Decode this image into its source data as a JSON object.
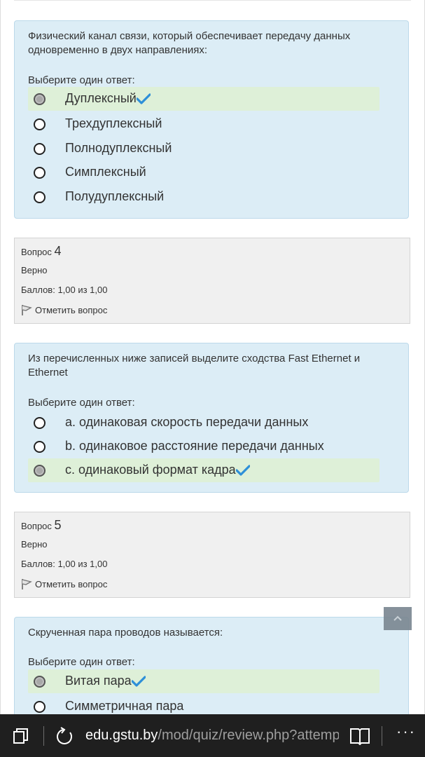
{
  "q3": {
    "text": "Физический канал связи, который обеспечивает передачу данных одновременно в двух направлениях:",
    "prompt": "Выберите один ответ:",
    "answers": [
      {
        "label": "Дуплексный",
        "checked": true,
        "correct": true
      },
      {
        "label": "Трехдуплексный",
        "checked": false,
        "correct": false
      },
      {
        "label": "Полнодуплексный",
        "checked": false,
        "correct": false
      },
      {
        "label": "Симплексный",
        "checked": false,
        "correct": false
      },
      {
        "label": "Полудуплексный",
        "checked": false,
        "correct": false
      }
    ]
  },
  "qb4": {
    "label": "Вопрос",
    "number": "4",
    "status": "Верно",
    "score": "Баллов: 1,00 из 1,00",
    "flag": "Отметить вопрос"
  },
  "q4": {
    "text": "Из перечисленных ниже записей выделите сходства Fast Ethernet и Ethernet",
    "prompt": "Выберите один ответ:",
    "answers": [
      {
        "label": "a. одинаковая скорость передачи данных",
        "checked": false,
        "correct": false
      },
      {
        "label": "b. одинаковое расстояние передачи данных",
        "checked": false,
        "correct": false
      },
      {
        "label": "c. одинаковый формат кадра",
        "checked": true,
        "correct": true
      }
    ]
  },
  "qb5": {
    "label": "Вопрос",
    "number": "5",
    "status": "Верно",
    "score": "Баллов: 1,00 из 1,00",
    "flag": "Отметить вопрос"
  },
  "q5": {
    "text": "Скрученная пара проводов называется:",
    "prompt": "Выберите один ответ:",
    "answers": [
      {
        "label": "Витая пара",
        "checked": true,
        "correct": true
      },
      {
        "label": "Симметричная пара",
        "checked": false,
        "correct": false
      }
    ]
  },
  "taskbar": {
    "url_host": "edu.gstu.by",
    "url_path": "/mod/quiz/review.php?attempt=",
    "more": "···"
  },
  "colors": {
    "question_bg": "#dcedf6",
    "correct_bg": "#def0d8",
    "check": "#2d8fd8",
    "info_bg": "#f0f0f0",
    "taskbar": "#1f1f1f"
  }
}
